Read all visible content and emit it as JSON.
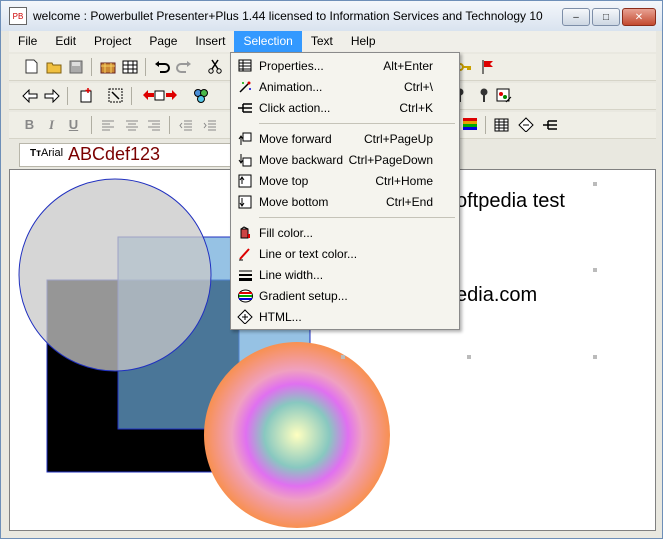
{
  "window": {
    "title": "welcome : Powerbullet Presenter+Plus 1.44 licensed to Information Services and Technology 10",
    "app_icon_text": "PB",
    "minimize": "–",
    "maximize": "□",
    "close": "✕"
  },
  "menubar": {
    "items": [
      {
        "label": "File"
      },
      {
        "label": "Edit"
      },
      {
        "label": "Project"
      },
      {
        "label": "Page"
      },
      {
        "label": "Insert"
      },
      {
        "label": "Selection"
      },
      {
        "label": "Text"
      },
      {
        "label": "Help"
      }
    ]
  },
  "fontbar": {
    "font_name": "Arial",
    "sample": "ABCdef123"
  },
  "canvas": {
    "text1": "oftpedia test",
    "text2": "edia.com"
  },
  "selection_menu": {
    "group1": [
      {
        "label": "Properties...",
        "shortcut": "Alt+Enter",
        "icon": "properties-icon",
        "glyph": "▦"
      },
      {
        "label": "Animation...",
        "shortcut": "Ctrl+\\",
        "icon": "animation-icon",
        "glyph": "✨"
      },
      {
        "label": "Click action...",
        "shortcut": "Ctrl+K",
        "icon": "click-action-icon",
        "glyph": "⋲"
      }
    ],
    "group2": [
      {
        "label": "Move forward",
        "shortcut": "Ctrl+PageUp",
        "icon": "move-forward-icon",
        "glyph": "⇧"
      },
      {
        "label": "Move backward",
        "shortcut": "Ctrl+PageDown",
        "icon": "move-backward-icon",
        "glyph": "⇩"
      },
      {
        "label": "Move top",
        "shortcut": "Ctrl+Home",
        "icon": "move-top-icon",
        "glyph": "⤒"
      },
      {
        "label": "Move bottom",
        "shortcut": "Ctrl+End",
        "icon": "move-bottom-icon",
        "glyph": "⤓"
      }
    ],
    "group3": [
      {
        "label": "Fill color...",
        "shortcut": "",
        "icon": "fill-color-icon",
        "glyph": "🪣"
      },
      {
        "label": "Line or text color...",
        "shortcut": "",
        "icon": "line-color-icon",
        "glyph": "✎"
      },
      {
        "label": "Line width...",
        "shortcut": "",
        "icon": "line-width-icon",
        "glyph": "≡"
      },
      {
        "label": "Gradient setup...",
        "shortcut": "",
        "icon": "gradient-icon",
        "glyph": "◍"
      },
      {
        "label": "HTML...",
        "shortcut": "",
        "icon": "html-icon",
        "glyph": "◈"
      }
    ]
  },
  "toolbar1_icons": [
    "new-file-icon",
    "open-folder-icon",
    "save-icon",
    "package-icon",
    "grid-icon",
    "undo-icon",
    "redo-icon",
    "cut-icon",
    "key-icon",
    "flag-icon"
  ],
  "toolbar2_icons": [
    "arrow-left-icon",
    "arrow-right-icon",
    "add-page-icon",
    "select-tool-icon",
    "move-pages-icon",
    "group-icon",
    "pin-icon",
    "palette-icon"
  ],
  "toolbar3_icons": [
    "bold-icon",
    "italic-icon",
    "underline-icon",
    "align-left-icon",
    "align-center-icon",
    "align-right-icon",
    "indent-icon",
    "outdent-icon",
    "gradient-tool-icon",
    "table-icon",
    "html-tool-icon",
    "action-tool-icon"
  ],
  "colors": {
    "menu_highlight": "#3399ff",
    "font_sample": "#7a0000"
  }
}
